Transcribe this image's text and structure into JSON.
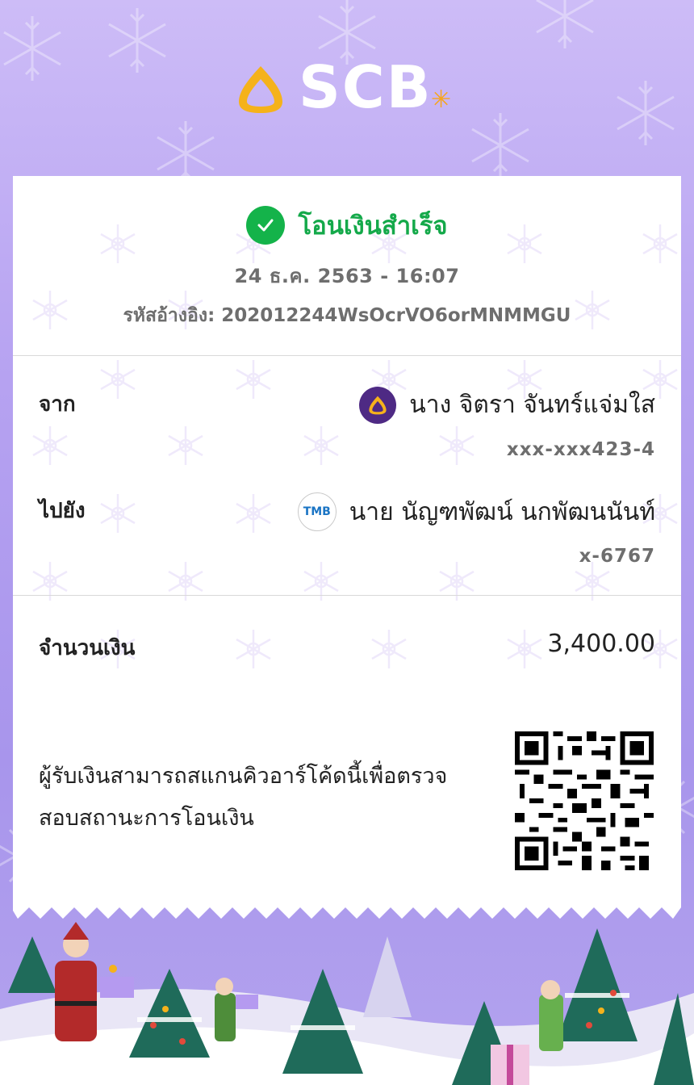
{
  "brand": {
    "name": "SCB",
    "logo_color": "#f5b21b"
  },
  "status": {
    "text": "โอนเงินสำเร็จ",
    "color": "#14b34a",
    "icon": "check-circle-icon"
  },
  "datetime": "24 ธ.ค. 2563 - 16:07",
  "reference": {
    "label": "รหัสอ้างอิง:",
    "value": "202012244WsOcrVO6orMNMMGU"
  },
  "from": {
    "label": "จาก",
    "name": "นาง จิตรา จันทร์แจ่มใส",
    "account": "xxx-xxx423-4",
    "bank_icon": "scb-bank-icon"
  },
  "to": {
    "label": "ไปยัง",
    "name": "นาย นัญฑพัฒน์ นกพัฒนนันท์",
    "account": "x-6767",
    "bank_icon": "tmb-bank-icon",
    "bank_text": "TMB"
  },
  "amount": {
    "label": "จำนวนเงิน",
    "value": "3,400.00"
  },
  "qr": {
    "note": "ผู้รับเงินสามารถสแกนคิวอาร์โค้ดนี้เพื่อตรวจสอบสถานะการโอนเงิน",
    "icon": "qr-code-icon"
  },
  "theme": {
    "background": "#b6a2f1",
    "accent": "#4e2a84"
  }
}
